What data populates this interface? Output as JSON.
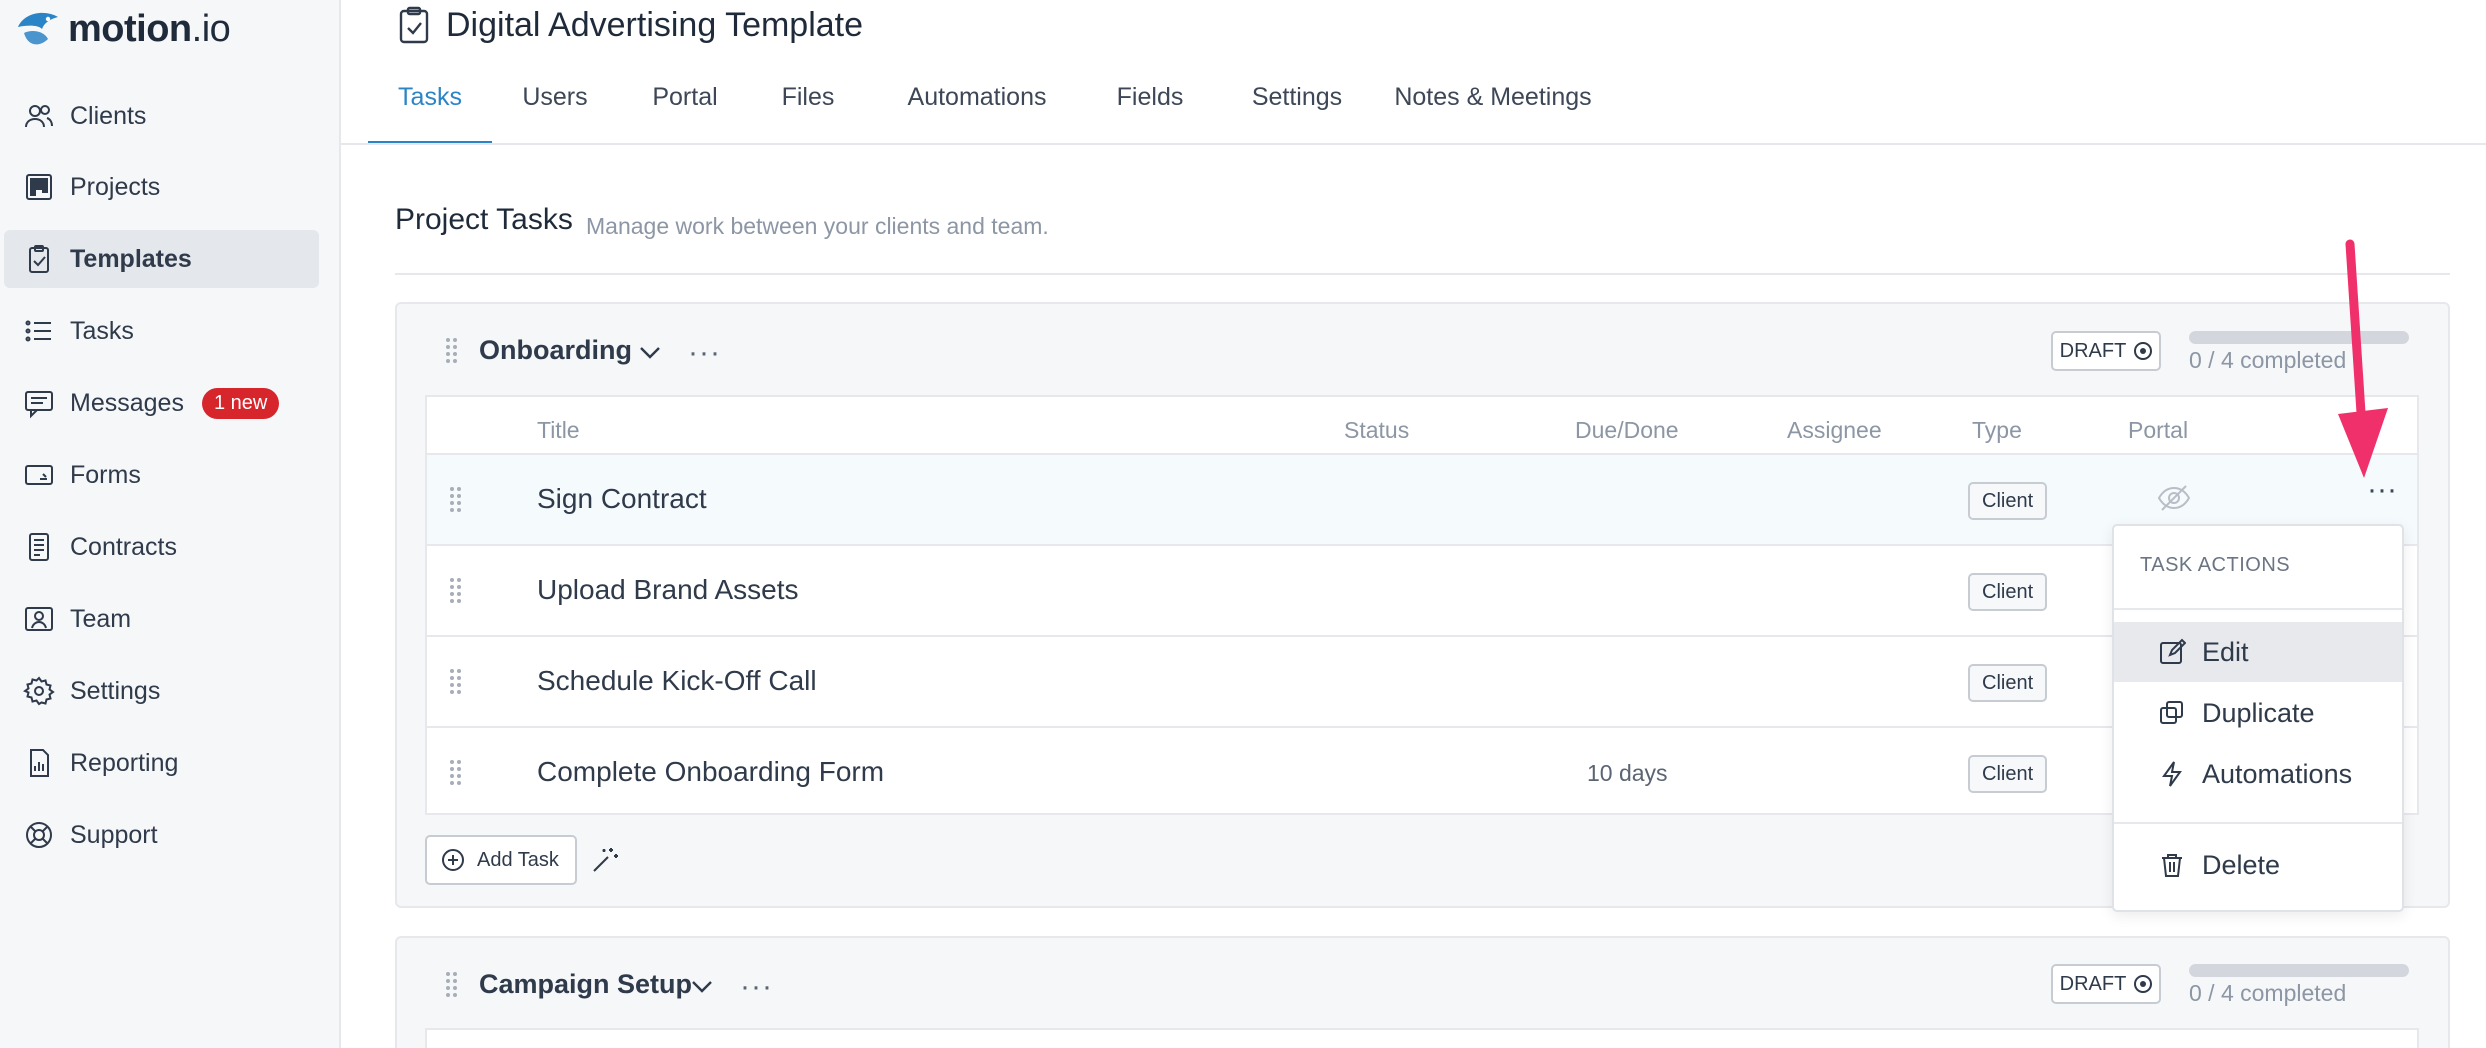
{
  "app": {
    "logo_text": "motion",
    "logo_suffix": ".io"
  },
  "sidebar": {
    "items": [
      {
        "label": "Clients",
        "icon": "users-icon"
      },
      {
        "label": "Projects",
        "icon": "kanban-icon"
      },
      {
        "label": "Templates",
        "icon": "clipboard-check-icon",
        "active": true
      },
      {
        "label": "Tasks",
        "icon": "list-icon"
      },
      {
        "label": "Messages",
        "icon": "message-icon",
        "badge": "1 new"
      },
      {
        "label": "Forms",
        "icon": "form-icon"
      },
      {
        "label": "Contracts",
        "icon": "document-icon"
      },
      {
        "label": "Team",
        "icon": "team-icon"
      },
      {
        "label": "Settings",
        "icon": "gear-icon"
      },
      {
        "label": "Reporting",
        "icon": "report-icon"
      },
      {
        "label": "Support",
        "icon": "lifebuoy-icon"
      }
    ]
  },
  "header": {
    "title": "Digital Advertising Template",
    "tabs": [
      "Tasks",
      "Users",
      "Portal",
      "Files",
      "Automations",
      "Fields",
      "Settings",
      "Notes & Meetings"
    ],
    "active_tab": "Tasks"
  },
  "section": {
    "title": "Project Tasks",
    "subtitle": "Manage work between your clients and team."
  },
  "groups": [
    {
      "name": "Onboarding",
      "status": "DRAFT",
      "progress_text": "0 / 4 completed",
      "progress": 0,
      "columns": [
        "Title",
        "Status",
        "Due/Done",
        "Assignee",
        "Type",
        "Portal"
      ],
      "tasks": [
        {
          "title": "Sign Contract",
          "due": "",
          "type": "Client"
        },
        {
          "title": "Upload Brand Assets",
          "due": "",
          "type": "Client"
        },
        {
          "title": "Schedule Kick-Off Call",
          "due": "",
          "type": "Client"
        },
        {
          "title": "Complete Onboarding Form",
          "due": "10 days",
          "type": "Client"
        }
      ],
      "add_task_label": "Add Task"
    },
    {
      "name": "Campaign Setup",
      "status": "DRAFT",
      "progress_text": "0 / 4 completed",
      "progress": 0
    }
  ],
  "task_menu": {
    "heading": "TASK ACTIONS",
    "items": [
      {
        "label": "Edit",
        "icon": "edit-icon",
        "active": true
      },
      {
        "label": "Duplicate",
        "icon": "duplicate-icon"
      },
      {
        "label": "Automations",
        "icon": "lightning-icon"
      },
      {
        "label": "Delete",
        "icon": "trash-icon"
      }
    ]
  },
  "colors": {
    "accent": "#2b84c6",
    "badge": "#d7262b",
    "arrow": "#f0306a"
  }
}
